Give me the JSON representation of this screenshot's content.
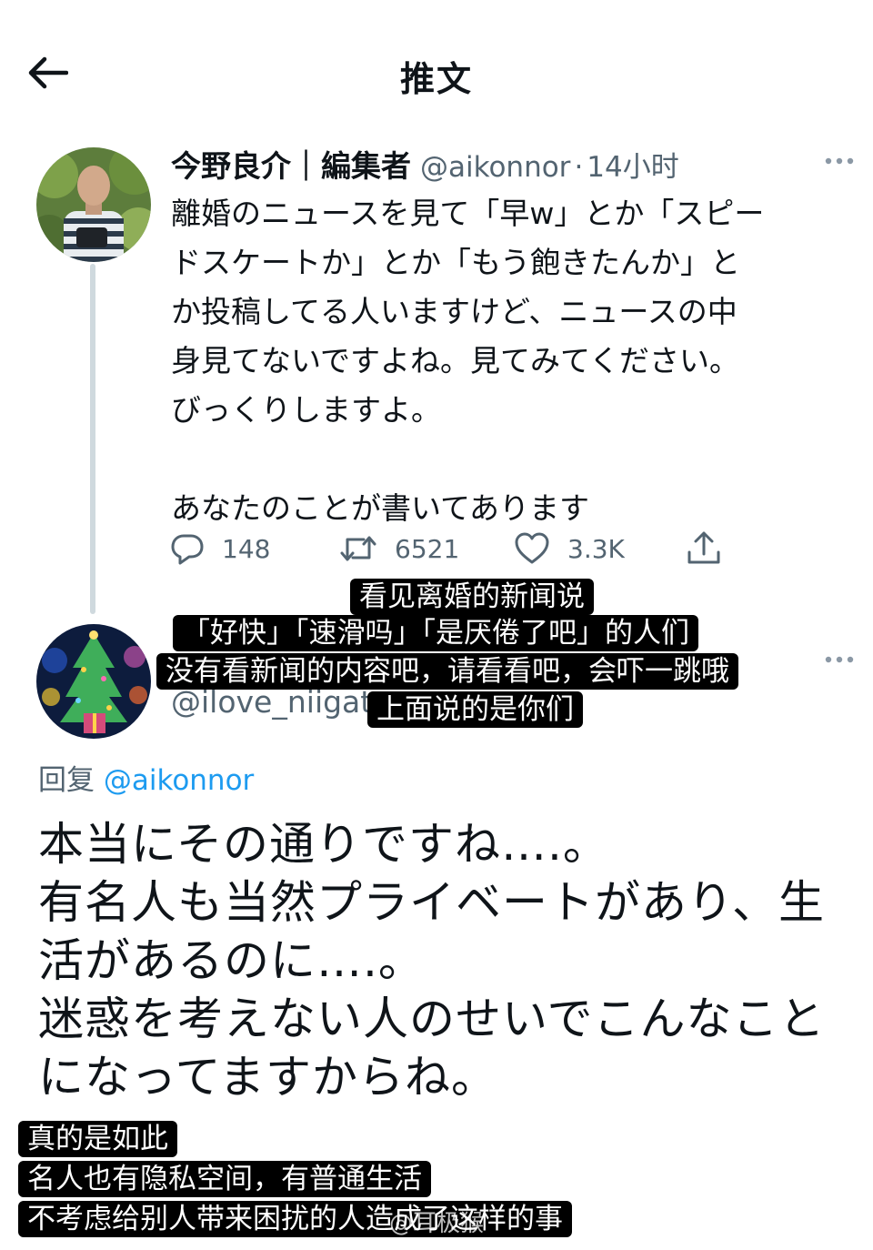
{
  "header": {
    "title": "推文"
  },
  "tweet": {
    "author_name": "今野良介｜編集者",
    "handle": "@aikonnor",
    "time": "14小时",
    "body_lines": [
      "離婚のニュースを見て「早w」とか「スピー",
      "ドスケートか」とか「もう飽きたんか」と",
      "か投稿してる人いますけど、ニュースの中",
      "身見てないですよね。見てみてください。",
      "びっくりしますよ。"
    ],
    "body_last_line": "あなたのことが書いてあります",
    "stats": {
      "replies": "148",
      "retweets": "6521",
      "likes": "3.3K"
    }
  },
  "reply": {
    "handle": "@ilove_niigata",
    "replying_prefix": "回复",
    "replying_to": "@aikonnor",
    "body_lines": [
      "本当にその通りですね….。",
      "有名人も当然プライベートがあり、生",
      "活があるのに….。",
      "迷惑を考えない人のせいでこんなこと",
      "になってますからね。"
    ]
  },
  "captions": {
    "top": [
      "看见离婚的新闻说",
      "「好快」「速滑吗」「是厌倦了吧」的人们",
      "没有看新闻的内容吧，请看看吧，会吓一跳哦",
      "上面说的是你们"
    ],
    "bottom": [
      "真的是如此",
      "名人也有隐私空间，有普通生活",
      "不考虑给别人带来困扰的人造成了这样的事"
    ]
  },
  "watermark": "@耳极猴",
  "colors": {
    "text": "#0f1419",
    "secondary": "#536471",
    "link": "#1d9bf0",
    "thread_line": "#cfd9de"
  },
  "icons": [
    "back-arrow-icon",
    "more-icon",
    "reply-icon",
    "retweet-icon",
    "like-icon",
    "share-icon"
  ]
}
